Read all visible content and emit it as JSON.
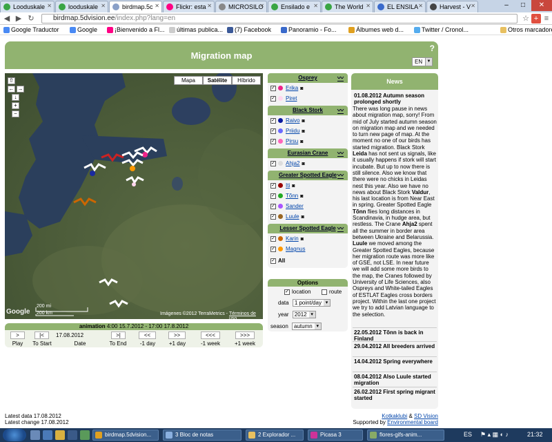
{
  "browser": {
    "tabs": [
      {
        "title": "Looduskale",
        "color": "#3aa544"
      },
      {
        "title": "looduskale",
        "color": "#3aa544"
      },
      {
        "title": "birdmap.5c",
        "color": "#8aa0c8"
      },
      {
        "title": "Flickr: esta",
        "color": "#ff0084"
      },
      {
        "title": "MICROSILO",
        "color": "#888888"
      },
      {
        "title": "Ensilado e",
        "color": "#3aa544"
      },
      {
        "title": "The World",
        "color": "#3aa544"
      },
      {
        "title": "EL ENSILA",
        "color": "#3a6acb"
      },
      {
        "title": "Harvest - V",
        "color": "#444444"
      }
    ],
    "url_domain": "birdmap.5dvision.ee",
    "url_path": "/index.php?lang=en",
    "bookmarks": [
      {
        "label": "Google Traductor",
        "color": "#4a8af4"
      },
      {
        "label": "Google",
        "color": "#4a8af4"
      },
      {
        "label": "¡Bienvenido a Fl...",
        "color": "#ff0084"
      },
      {
        "label": "últimas publica...",
        "color": "#cccccc"
      },
      {
        "label": "(7) Facebook",
        "color": "#3b5998"
      },
      {
        "label": "Panoramio - Fo...",
        "color": "#3a6acb"
      },
      {
        "label": "Álbumes web d...",
        "color": "#e0a020"
      },
      {
        "label": "Twitter / Cronol...",
        "color": "#55acee"
      },
      {
        "label": "Otros marcadores",
        "color": "#e8c060"
      }
    ]
  },
  "page": {
    "title": "Migration map",
    "help": "?",
    "lang": "EN"
  },
  "map": {
    "buttons": [
      "Mapa",
      "Satélite",
      "Híbrido"
    ],
    "scale_top": "200 mi",
    "scale_bottom": "200 km",
    "google": "Google",
    "copyright": "Imágenes ©2012 TerraMetrics -",
    "terms": "Términos de uso"
  },
  "animation": {
    "title": "animation",
    "range": "4:00 15.7.2012 - 17:00 17.8.2012",
    "date": "17.08.2012",
    "buttons": [
      ">",
      "|<",
      ">|",
      "<<",
      ">>",
      "<<<",
      ">>>"
    ],
    "labels": [
      "Play",
      "To Start",
      "Date",
      "To End",
      "-1 day",
      "+1 day",
      "-1 week",
      "+1 week"
    ]
  },
  "species": [
    {
      "name": "Osprey",
      "birds": [
        {
          "name": "Erika",
          "color": "#ee2288",
          "photo": true
        },
        {
          "name": "Piret",
          "color": "#ffd6ee",
          "photo": false
        }
      ]
    },
    {
      "name": "Black Stork",
      "birds": [
        {
          "name": "Raivo",
          "color": "#0a1aa0",
          "photo": true
        },
        {
          "name": "Priidu",
          "color": "#6a6aff",
          "photo": true
        },
        {
          "name": "Pirsu",
          "color": "#ff66bb",
          "photo": true
        }
      ]
    },
    {
      "name": "Eurasian Crane",
      "birds": [
        {
          "name": "Ahja2",
          "color": "#dddddd",
          "photo": true
        }
      ]
    },
    {
      "name": "Greater Spotted Eagle",
      "birds": [
        {
          "name": "Iti",
          "color": "#990000",
          "photo": true
        },
        {
          "name": "Tõnn",
          "color": "#22aa22",
          "photo": true
        },
        {
          "name": "Sander",
          "color": "#aa55ff",
          "photo": false
        },
        {
          "name": "Luule",
          "color": "#996622",
          "photo": true
        }
      ]
    },
    {
      "name": "Lesser Spotted Eagle",
      "birds": [
        {
          "name": "Karin",
          "color": "#cc6600",
          "photo": true
        },
        {
          "name": "Magnus",
          "color": "#ff9900",
          "photo": false
        }
      ]
    }
  ],
  "all_label": "All",
  "options": {
    "title": "Options",
    "location": "location",
    "route": "route",
    "data_label": "data",
    "data_value": "1 point/day",
    "year_label": "year",
    "year_value": "2012",
    "season_label": "season",
    "season_value": "autumn"
  },
  "news": {
    "title": "News",
    "first_headline": "01.08.2012 Autumn season prolonged shortly",
    "body_html": "There was long pause in news about migration map, sorry! From mid of July started autumn season on migration map and we needed to turn new page of map. At the moment no one of our birds has started migration. Black Stork <b>Leida</b> has not sent us signals, like it usually happens if stork will start incubate. But up to now there is still silence. Also we know that there were no chicks in Leidas nest this year. Also we have no news about Black Stork <b>Valdur</b>, his last location is from Near East in spring. Greater Spotted Eagle <b>Tõnn</b> flies long distances in Scandinavia, in hudge area, but restless. The Crane <b>Ahja2</b> spent all the summer in border area between Ukraine and Belarussia. <b>Luule</b> we moved among the Greater Spotted Eagles, because her migration route was more like of GSE, not LSE. In near future we will add some more birds to the map, the Cranes followed by University of Life Sciences, also Ospreys and White-tailed Eagles of ESTLAT Eagles cross borders project. Within the last one project we try to add Latvian language to the selection.",
    "headlines": [
      "22.05.2012 Tõnn is back in Finland",
      "29.04.2012 All breeders arrived",
      "14.04.2012 Spring everywhere",
      "08.04.2012 Also Luule started migration",
      "26.02.2012 First spring migrant started"
    ]
  },
  "footer": {
    "latest_data": "Latest data 17.08.2012",
    "latest_change": "Latest change 17.08.2012",
    "kotkaklubi": "Kotkaklubi",
    "amp": "&",
    "sdvision": "SD Vision",
    "supported": "Supported by",
    "board": "Environmental board"
  },
  "taskbar": {
    "items": [
      {
        "label": "birdmap.5dvision...",
        "color": "#e0a020"
      },
      {
        "label": "3 Bloc de notas",
        "color": "#8ab0e0"
      },
      {
        "label": "2 Explorador ...",
        "color": "#e8c060"
      },
      {
        "label": "Picasa 3",
        "color": "#cc3399"
      },
      {
        "label": "flores-gifs-anim...",
        "color": "#88aa66"
      }
    ],
    "lang": "ES",
    "time": "21:32"
  }
}
